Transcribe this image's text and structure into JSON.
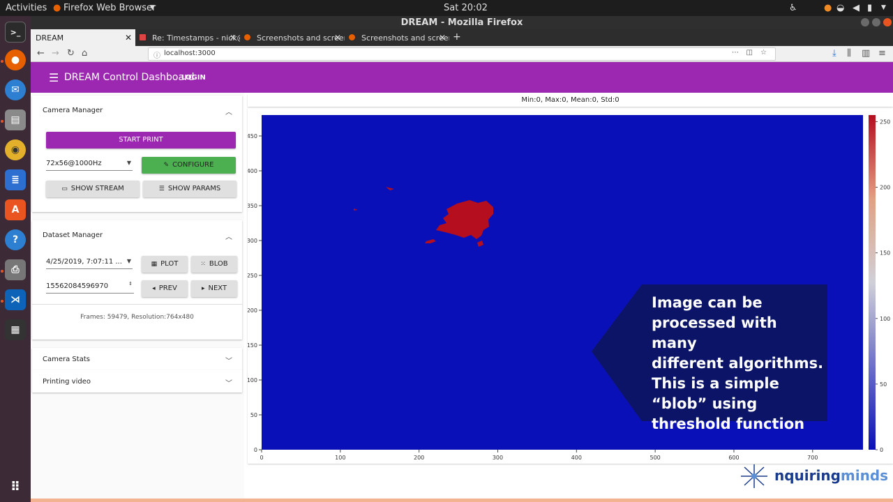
{
  "system_bar": {
    "activities": "Activities",
    "app_menu": "Firefox Web Browser",
    "clock": "Sat 20:02"
  },
  "window": {
    "title": "DREAM - Mozilla Firefox"
  },
  "tabs": [
    {
      "label": "DREAM"
    },
    {
      "label": "Re: Timestamps - nick@"
    },
    {
      "label": "Screenshots and screen"
    },
    {
      "label": "Screenshots and screen"
    }
  ],
  "url": "localhost:3000",
  "app": {
    "title": "DREAM Control Dashboard",
    "login": "LOGIN"
  },
  "camera_manager": {
    "header": "Camera Manager",
    "start_print": "START PRINT",
    "mode_select": "72x56@1000Hz",
    "configure": "CONFIGURE",
    "show_stream": "SHOW STREAM",
    "show_params": "SHOW PARAMS"
  },
  "dataset_manager": {
    "header": "Dataset Manager",
    "dataset_select": "4/25/2019, 7:07:11 ...",
    "plot": "PLOT",
    "blob": "BLOB",
    "frame_id": "15562084596970",
    "prev": "PREV",
    "next": "NEXT",
    "info": "Frames: 59479, Resolution:764x480"
  },
  "camera_stats": {
    "header": "Camera Stats"
  },
  "printing_video": {
    "header": "Printing video"
  },
  "plot": {
    "stats_text": "Min:0, Max:0, Mean:0, Std:0"
  },
  "chart_data": {
    "type": "heatmap",
    "xlim": [
      0,
      764
    ],
    "ylim": [
      0,
      480
    ],
    "x_ticks": [
      0,
      100,
      200,
      300,
      400,
      500,
      600,
      700
    ],
    "y_ticks": [
      0,
      50,
      100,
      150,
      200,
      250,
      300,
      350,
      400,
      450
    ],
    "colorbar": {
      "range": [
        0,
        255
      ],
      "ticks": [
        0,
        50,
        100,
        150,
        200,
        250
      ]
    },
    "background_value": 0,
    "blob_value": 255
  },
  "callout": {
    "lines": [
      "Image can be",
      "processed with many",
      "different algorithms.",
      "This is a simple",
      "“blob” using",
      "threshold function"
    ]
  },
  "logo": {
    "text_a": "nquiring",
    "text_b": "minds"
  },
  "colors": {
    "accent": "#9c27b0",
    "configure": "#4caf50",
    "heat_low": "#0a10b8",
    "heat_high": "#b50e1e",
    "callout": "#0b1466"
  }
}
